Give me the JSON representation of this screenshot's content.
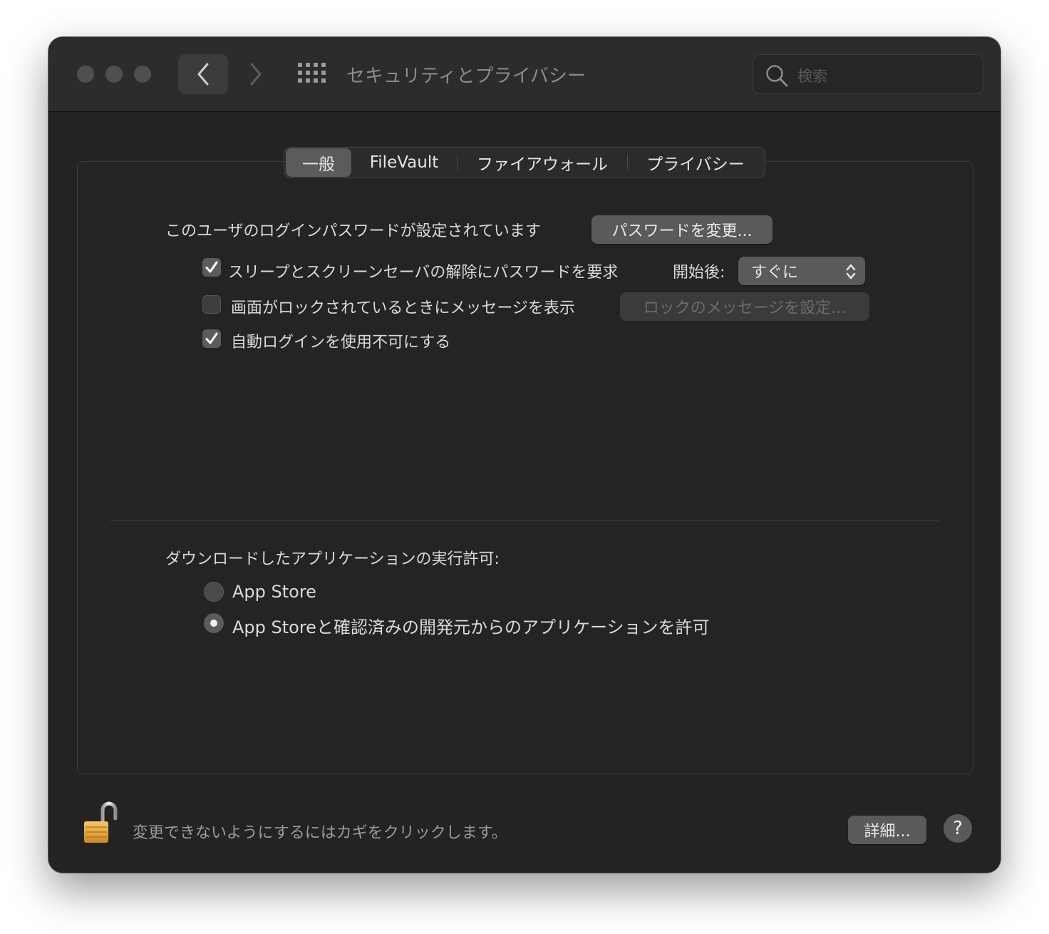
{
  "window": {
    "title": "セキュリティとプライバシー"
  },
  "search": {
    "placeholder": "検索"
  },
  "tabs": [
    {
      "label": "一般",
      "active": true
    },
    {
      "label": "FileVault",
      "active": false
    },
    {
      "label": "ファイアウォール",
      "active": false
    },
    {
      "label": "プライバシー",
      "active": false
    }
  ],
  "general": {
    "password_status": "このユーザのログインパスワードが設定されています",
    "change_password_button": "パスワードを変更...",
    "require_password": {
      "label": "スリープとスクリーンセーバの解除にパスワードを要求",
      "checked": true
    },
    "after_label": "開始後:",
    "after_select": {
      "value": "すぐに"
    },
    "show_message": {
      "label": "画面がロックされているときにメッセージを表示",
      "checked": false
    },
    "set_lock_message_button": "ロックのメッセージを設定...",
    "disable_auto_login": {
      "label": "自動ログインを使用不可にする",
      "checked": true
    }
  },
  "downloads": {
    "heading": "ダウンロードしたアプリケーションの実行許可:",
    "options": [
      {
        "label": "App Store",
        "selected": false
      },
      {
        "label": "App Storeと確認済みの開発元からのアプリケーションを許可",
        "selected": true
      }
    ]
  },
  "footer": {
    "lock_text": "変更できないようにするにはカギをクリックします。",
    "advanced_button": "詳細...",
    "help_button": "?"
  },
  "colors": {
    "window_bg": "#232323",
    "titlebar_bg": "#2c2c2c",
    "button_bg": "#5a5a5a",
    "text": "#dadada"
  }
}
